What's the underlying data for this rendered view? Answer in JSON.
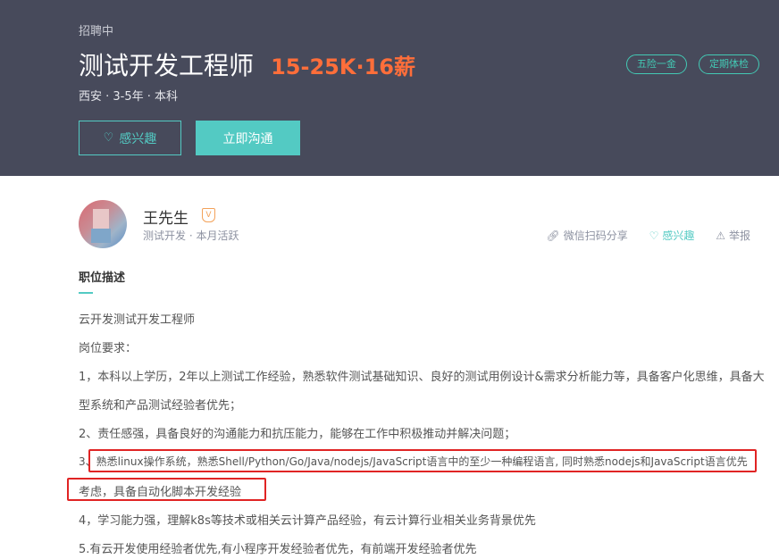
{
  "header": {
    "status": "招聘中",
    "job_title": "测试开发工程师",
    "salary": "15-25K·16薪",
    "meta": "西安 · 3-5年 · 本科",
    "tags": [
      "五险一金",
      "定期体检"
    ],
    "interest_button": "感兴趣",
    "chat_button": "立即沟通"
  },
  "recruiter": {
    "name": "王先生",
    "badge": "V",
    "meta": "测试开发 · 本月活跃",
    "actions": {
      "share": "微信扫码分享",
      "interest": "感兴趣",
      "report": "举报"
    }
  },
  "description": {
    "section_title": "职位描述",
    "lines": [
      "云开发测试开发工程师",
      "岗位要求：",
      "1，本科以上学历，2年以上测试工作经验，熟悉软件测试基础知识、良好的测试用例设计&需求分析能力等，具备客户化思维，具备大",
      "型系统和产品测试经验者优先；",
      "2、责任感强，具备良好的沟通能力和抗压能力，能够在工作中积极推动并解决问题；",
      "3、熟悉linux操作系统，熟悉Shell/Python/Go/Java/nodejs/JavaScript语言中的至少一种编程语言, 同时熟悉nodejs和JavaScript语言优先",
      "考虑，具备自动化脚本开发经验",
      "4，学习能力强，理解k8s等技术或相关云计算产品经验，有云计算行业相关业务背景优先",
      "5.有云开发使用经验者优先,有小程序开发经验者优先，有前端开发经验者优先"
    ]
  },
  "colors": {
    "header_bg": "#474a5b",
    "accent": "#53cac3",
    "salary": "#ff6e3a",
    "highlight_box": "#e02424"
  },
  "icons": [
    "heart-icon",
    "share-link-icon",
    "heart-outline-icon",
    "warning-icon",
    "verified-badge-icon"
  ]
}
